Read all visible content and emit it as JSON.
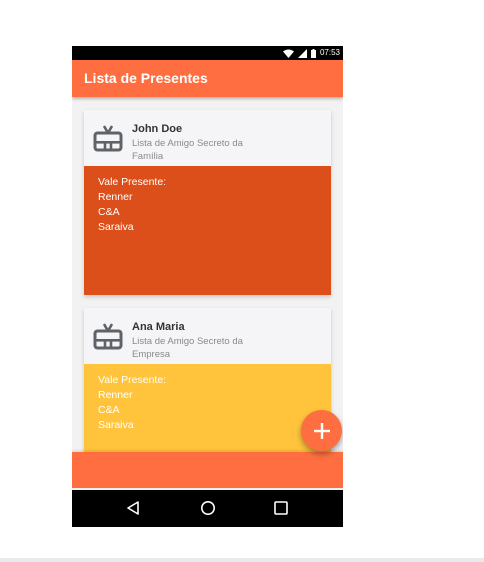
{
  "status_bar": {
    "time": "07:53",
    "icons": [
      "wifi-icon",
      "signal-icon",
      "battery-icon"
    ]
  },
  "app_bar": {
    "title": "Lista de Presentes",
    "color": "#ff6e40"
  },
  "cards": [
    {
      "name": "John Doe",
      "subtitle": "Lista de Amigo Secreto da Família",
      "icon": "gift-card-icon",
      "panel_color": "#dd4f1a",
      "gift_title": "Vale Presente:",
      "gifts": [
        "Renner",
        "C&A",
        "Saraiva"
      ]
    },
    {
      "name": "Ana Maria",
      "subtitle": "Lista de Amigo Secreto da Empresa",
      "icon": "gift-card-icon",
      "panel_color": "#ffc43c",
      "gift_title": "Vale Presente:",
      "gifts": [
        "Renner",
        "C&A",
        "Saraiva"
      ]
    }
  ],
  "fab": {
    "icon": "plus-icon",
    "color": "#ff6e40"
  },
  "nav_bar": {
    "icons": [
      "back-icon",
      "home-icon",
      "recent-apps-icon"
    ]
  }
}
